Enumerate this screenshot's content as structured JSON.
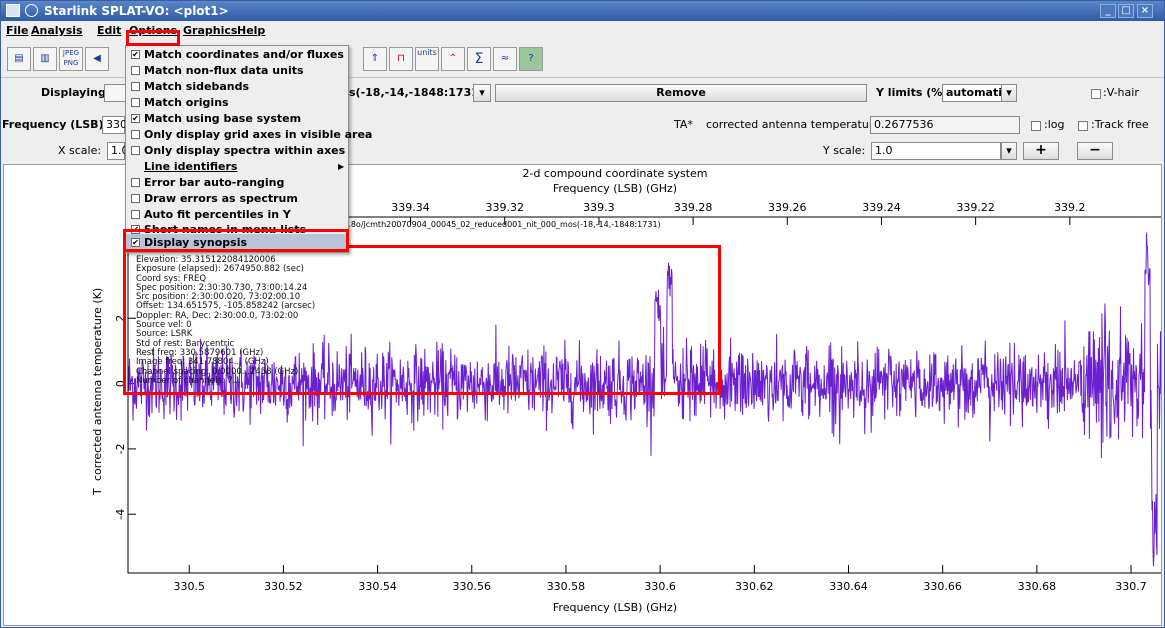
{
  "window": {
    "title": "Starlink SPLAT-VO: <plot1>"
  },
  "menubar": [
    "File",
    "Analysis",
    "Edit",
    "Options",
    "Graphics",
    "Help"
  ],
  "toolbar": {
    "jpeg_label": "JPEG PNG",
    "units_label": "units",
    "sum_label": "Σ"
  },
  "controls": {
    "displaying_label": "Displaying:",
    "displaying_value": "s(-18,-14,-1848:1731)",
    "remove_label": "Remove",
    "ylimits_label": "Y limits (%):",
    "ylimits_value": "automatic",
    "vhair_label": ":V-hair",
    "frequency_label": "Frequency (LSB):",
    "frequency_value": "330",
    "ta_label": "TA*",
    "ta_desc": "corrected antenna temperature:",
    "ta_value": "0.2677536",
    "log_label": ":log",
    "trackfree_label": ":Track free",
    "xscale_label": "X scale:",
    "xscale_value": "1.0",
    "yscale_label": "Y scale:",
    "yscale_value": "1.0",
    "plus_label": "+",
    "minus_label": "−"
  },
  "options_menu": [
    {
      "label": "Match coordinates and/or fluxes",
      "checked": true
    },
    {
      "label": "Match non-flux data units",
      "checked": false
    },
    {
      "label": "Match sidebands",
      "checked": false
    },
    {
      "label": "Match origins",
      "checked": false
    },
    {
      "label": "Match using base system",
      "checked": true
    },
    {
      "label": "Only display grid axes in visible area",
      "checked": false
    },
    {
      "label": "Only display spectra within axes",
      "checked": false
    },
    {
      "label": "Line identifiers",
      "submenu": true
    },
    {
      "label": "Error bar auto-ranging",
      "checked": false
    },
    {
      "label": "Draw errors as spectrum",
      "checked": false
    },
    {
      "label": "Auto fit percentiles in Y",
      "checked": false
    },
    {
      "label": "Short names in menu lists",
      "checked": true
    },
    {
      "label": "Display synopsis",
      "checked": true,
      "selected": true
    }
  ],
  "synopsis": [
    "Elevation: 35.315122084120006",
    "Exposure (elapsed): 2674950.882 (sec)",
    "Coord sys: FREQ",
    "Spec position: 2:30:30.730, 73:00:14.24",
    "Src position: 2:30:00.020, 73:02:00.10",
    "Offset: 134.651575, -105.858242 (arcsec)",
    "Doppler: RA, Dec: 2:30:00.0, 73:02:00",
    "Source vel: 0",
    "Source: LSRK",
    "Std of rest: Barycentric",
    "Rest freq: 330.5879601 (GHz)",
    "Image freq: 341.78804... (GHz)",
    "Channel spacing: 0.0000...2458 (GHz)",
    "Number of channels: 7..."
  ],
  "plot": {
    "title": "2-d compound coordinate system",
    "top_axis_label": "Frequency (LSB) (GHz)",
    "bottom_axis_label": "Frequency (LSB) (GHz)",
    "y_axis_label": "T",
    "y_axis_label_rest": "corrected antenna temperature (K)",
    "spectrum_name": "ARP/13coc18o/jcmth20070904_00045_02_reduced001_nit_000_mos(-18,-14,-1848:1731)",
    "series_color": "#6a1fd0"
  },
  "chart_data": {
    "type": "line",
    "title": "2-d compound coordinate system",
    "xlabel": "Frequency (LSB) (GHz)",
    "ylabel": "corrected antenna temperature (K)",
    "xlim": [
      330.487,
      330.707
    ],
    "ylim": [
      -5.8,
      5.1
    ],
    "x_ticks": [
      330.5,
      330.52,
      330.54,
      330.56,
      330.58,
      330.6,
      330.62,
      330.64,
      330.66,
      330.68,
      330.7
    ],
    "top_xlim": [
      339.4,
      339.18
    ],
    "top_ticks": [
      339.34,
      339.32,
      339.3,
      339.28,
      339.26,
      339.24,
      339.22,
      339.2
    ],
    "y_ticks": [
      -4,
      -2,
      0,
      2
    ],
    "noise_sigma": 0.55,
    "features": [
      {
        "x": 330.5995,
        "y": 2.9
      },
      {
        "x": 330.602,
        "y": 3.7
      },
      {
        "x": 330.7035,
        "y": 4.8
      },
      {
        "x": 330.705,
        "y": -5.6
      }
    ]
  }
}
